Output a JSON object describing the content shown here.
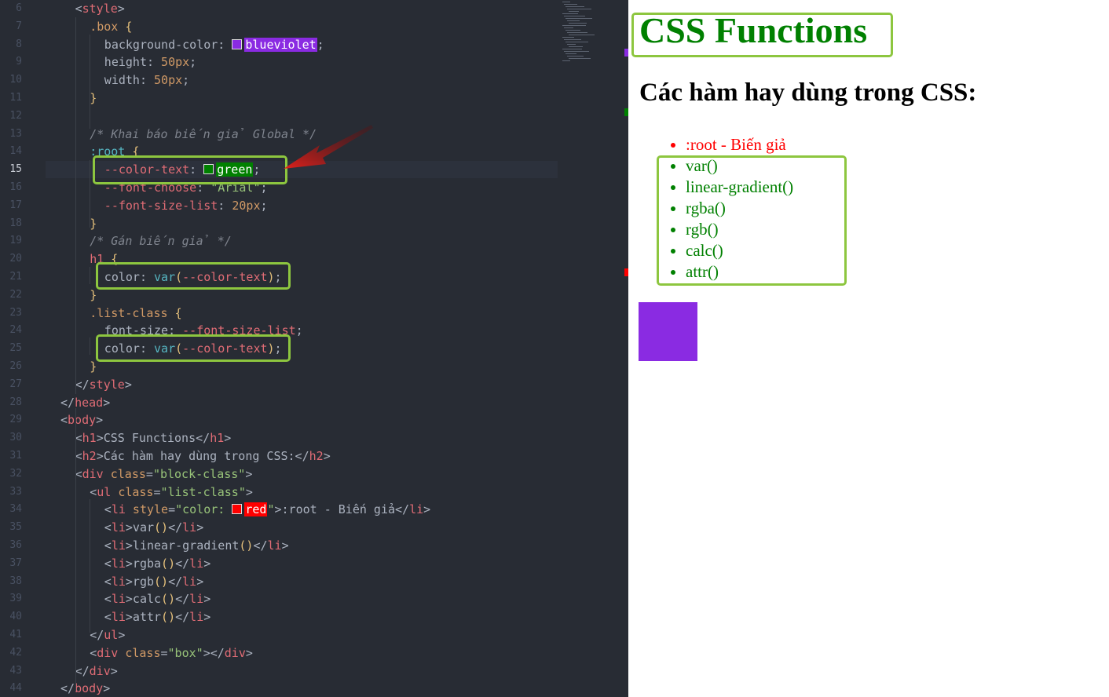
{
  "editor": {
    "current_line": 15,
    "lines": [
      {
        "n": 6,
        "indent": 1,
        "tokens": [
          [
            "t-br",
            "<"
          ],
          [
            "t-tag",
            "style"
          ],
          [
            "t-br",
            ">"
          ]
        ]
      },
      {
        "n": 7,
        "indent": 2,
        "tokens": [
          [
            "t-sel",
            ".box"
          ],
          [
            "t-br",
            " "
          ],
          [
            "t-cb",
            "{"
          ]
        ]
      },
      {
        "n": 8,
        "indent": 3,
        "tokens": [
          [
            "t-prop",
            "background-color: "
          ],
          [
            "swatch",
            "#8a2be2"
          ],
          [
            "hl:#8a2be2",
            "blueviolet"
          ],
          [
            "t-br",
            ";"
          ]
        ]
      },
      {
        "n": 9,
        "indent": 3,
        "tokens": [
          [
            "t-prop",
            "height: "
          ],
          [
            "t-num",
            "50px"
          ],
          [
            "t-br",
            ";"
          ]
        ]
      },
      {
        "n": 10,
        "indent": 3,
        "tokens": [
          [
            "t-prop",
            "width: "
          ],
          [
            "t-num",
            "50px"
          ],
          [
            "t-br",
            ";"
          ]
        ]
      },
      {
        "n": 11,
        "indent": 2,
        "tokens": [
          [
            "t-cb",
            "}"
          ]
        ]
      },
      {
        "n": 12,
        "indent": 0,
        "tokens": []
      },
      {
        "n": 13,
        "indent": 2,
        "tokens": [
          [
            "t-cm",
            "/* Khai báo biến giả Global */"
          ]
        ]
      },
      {
        "n": 14,
        "indent": 2,
        "tokens": [
          [
            "t-fn",
            ":root"
          ],
          [
            "t-br",
            " "
          ],
          [
            "t-cb",
            "{"
          ]
        ]
      },
      {
        "n": 15,
        "indent": 3,
        "tokens": [
          [
            "t-var",
            "--color-text"
          ],
          [
            "t-br",
            ": "
          ],
          [
            "swatch",
            "#008000"
          ],
          [
            "hl:#008000",
            "green"
          ],
          [
            "t-br",
            ";"
          ]
        ]
      },
      {
        "n": 16,
        "indent": 3,
        "tokens": [
          [
            "t-var",
            "--font-choose"
          ],
          [
            "t-br",
            ": "
          ],
          [
            "t-str",
            "\"Arial\""
          ],
          [
            "t-br",
            ";"
          ]
        ]
      },
      {
        "n": 17,
        "indent": 3,
        "tokens": [
          [
            "t-var",
            "--font-size-list"
          ],
          [
            "t-br",
            ": "
          ],
          [
            "t-num",
            "20px"
          ],
          [
            "t-br",
            ";"
          ]
        ]
      },
      {
        "n": 18,
        "indent": 2,
        "tokens": [
          [
            "t-cb",
            "}"
          ]
        ]
      },
      {
        "n": 19,
        "indent": 2,
        "tokens": [
          [
            "t-cm",
            "/* Gán biến giả */"
          ]
        ]
      },
      {
        "n": 20,
        "indent": 2,
        "tokens": [
          [
            "t-tag",
            "h1"
          ],
          [
            "t-br",
            " "
          ],
          [
            "t-cb",
            "{"
          ]
        ]
      },
      {
        "n": 21,
        "indent": 3,
        "tokens": [
          [
            "t-prop",
            "color: "
          ],
          [
            "t-fn",
            "var"
          ],
          [
            "t-cb",
            "("
          ],
          [
            "t-var",
            "--color-text"
          ],
          [
            "t-cb",
            ")"
          ],
          [
            "t-br",
            ";"
          ]
        ]
      },
      {
        "n": 22,
        "indent": 2,
        "tokens": [
          [
            "t-cb",
            "}"
          ]
        ]
      },
      {
        "n": 23,
        "indent": 2,
        "tokens": [
          [
            "t-sel",
            ".list-class"
          ],
          [
            "t-br",
            " "
          ],
          [
            "t-cb",
            "{"
          ]
        ]
      },
      {
        "n": 24,
        "indent": 3,
        "tokens": [
          [
            "t-prop",
            "font-size: "
          ],
          [
            "t-var",
            "--font-size-list"
          ],
          [
            "t-br",
            ";"
          ]
        ]
      },
      {
        "n": 25,
        "indent": 3,
        "tokens": [
          [
            "t-prop",
            "color: "
          ],
          [
            "t-fn",
            "var"
          ],
          [
            "t-cb",
            "("
          ],
          [
            "t-var",
            "--color-text"
          ],
          [
            "t-cb",
            ")"
          ],
          [
            "t-br",
            ";"
          ]
        ]
      },
      {
        "n": 26,
        "indent": 2,
        "tokens": [
          [
            "t-cb",
            "}"
          ]
        ]
      },
      {
        "n": 27,
        "indent": 1,
        "tokens": [
          [
            "t-br",
            "</"
          ],
          [
            "t-tag",
            "style"
          ],
          [
            "t-br",
            ">"
          ]
        ]
      },
      {
        "n": 28,
        "indent": 0,
        "tokens": [
          [
            "t-br",
            "</"
          ],
          [
            "t-tag",
            "head"
          ],
          [
            "t-br",
            ">"
          ]
        ]
      },
      {
        "n": 29,
        "indent": 0,
        "tokens": [
          [
            "t-br",
            "<"
          ],
          [
            "t-tag",
            "body"
          ],
          [
            "t-br",
            ">"
          ]
        ]
      },
      {
        "n": 30,
        "indent": 1,
        "tokens": [
          [
            "t-br",
            "<"
          ],
          [
            "t-tag",
            "h1"
          ],
          [
            "t-br",
            ">CSS Functions</"
          ],
          [
            "t-tag",
            "h1"
          ],
          [
            "t-br",
            ">"
          ]
        ]
      },
      {
        "n": 31,
        "indent": 1,
        "tokens": [
          [
            "t-br",
            "<"
          ],
          [
            "t-tag",
            "h2"
          ],
          [
            "t-br",
            ">Các hàm hay dùng trong CSS:</"
          ],
          [
            "t-tag",
            "h2"
          ],
          [
            "t-br",
            ">"
          ]
        ]
      },
      {
        "n": 32,
        "indent": 1,
        "tokens": [
          [
            "t-br",
            "<"
          ],
          [
            "t-tag",
            "div"
          ],
          [
            "t-br",
            " "
          ],
          [
            "t-attr",
            "class"
          ],
          [
            "t-br",
            "="
          ],
          [
            "t-str",
            "\"block-class\""
          ],
          [
            "t-br",
            ">"
          ]
        ]
      },
      {
        "n": 33,
        "indent": 2,
        "tokens": [
          [
            "t-br",
            "<"
          ],
          [
            "t-tag",
            "ul"
          ],
          [
            "t-br",
            " "
          ],
          [
            "t-attr",
            "class"
          ],
          [
            "t-br",
            "="
          ],
          [
            "t-str",
            "\"list-class\""
          ],
          [
            "t-br",
            ">"
          ]
        ]
      },
      {
        "n": 34,
        "indent": 3,
        "tokens": [
          [
            "t-br",
            "<"
          ],
          [
            "t-tag",
            "li"
          ],
          [
            "t-br",
            " "
          ],
          [
            "t-attr",
            "style"
          ],
          [
            "t-br",
            "="
          ],
          [
            "t-str",
            "\"color: "
          ],
          [
            "swatch",
            "#ff0000"
          ],
          [
            "hl:#ff0000",
            "red"
          ],
          [
            "t-str",
            "\""
          ],
          [
            "t-br",
            ">:root - Biến giả</"
          ],
          [
            "t-tag",
            "li"
          ],
          [
            "t-br",
            ">"
          ]
        ]
      },
      {
        "n": 35,
        "indent": 3,
        "tokens": [
          [
            "t-br",
            "<"
          ],
          [
            "t-tag",
            "li"
          ],
          [
            "t-br",
            ">var"
          ],
          [
            "t-cb",
            "()"
          ],
          [
            "t-br",
            "</"
          ],
          [
            "t-tag",
            "li"
          ],
          [
            "t-br",
            ">"
          ]
        ]
      },
      {
        "n": 36,
        "indent": 3,
        "tokens": [
          [
            "t-br",
            "<"
          ],
          [
            "t-tag",
            "li"
          ],
          [
            "t-br",
            ">linear-gradient"
          ],
          [
            "t-cb",
            "()"
          ],
          [
            "t-br",
            "</"
          ],
          [
            "t-tag",
            "li"
          ],
          [
            "t-br",
            ">"
          ]
        ]
      },
      {
        "n": 37,
        "indent": 3,
        "tokens": [
          [
            "t-br",
            "<"
          ],
          [
            "t-tag",
            "li"
          ],
          [
            "t-br",
            ">rgba"
          ],
          [
            "t-cb",
            "()"
          ],
          [
            "t-br",
            "</"
          ],
          [
            "t-tag",
            "li"
          ],
          [
            "t-br",
            ">"
          ]
        ]
      },
      {
        "n": 38,
        "indent": 3,
        "tokens": [
          [
            "t-br",
            "<"
          ],
          [
            "t-tag",
            "li"
          ],
          [
            "t-br",
            ">rgb"
          ],
          [
            "t-cb",
            "()"
          ],
          [
            "t-br",
            "</"
          ],
          [
            "t-tag",
            "li"
          ],
          [
            "t-br",
            ">"
          ]
        ]
      },
      {
        "n": 39,
        "indent": 3,
        "tokens": [
          [
            "t-br",
            "<"
          ],
          [
            "t-tag",
            "li"
          ],
          [
            "t-br",
            ">calc"
          ],
          [
            "t-cb",
            "()"
          ],
          [
            "t-br",
            "</"
          ],
          [
            "t-tag",
            "li"
          ],
          [
            "t-br",
            ">"
          ]
        ]
      },
      {
        "n": 40,
        "indent": 3,
        "tokens": [
          [
            "t-br",
            "<"
          ],
          [
            "t-tag",
            "li"
          ],
          [
            "t-br",
            ">attr"
          ],
          [
            "t-cb",
            "()"
          ],
          [
            "t-br",
            "</"
          ],
          [
            "t-tag",
            "li"
          ],
          [
            "t-br",
            ">"
          ]
        ]
      },
      {
        "n": 41,
        "indent": 2,
        "tokens": [
          [
            "t-br",
            "</"
          ],
          [
            "t-tag",
            "ul"
          ],
          [
            "t-br",
            ">"
          ]
        ]
      },
      {
        "n": 42,
        "indent": 2,
        "tokens": [
          [
            "t-br",
            "<"
          ],
          [
            "t-tag",
            "div"
          ],
          [
            "t-br",
            " "
          ],
          [
            "t-attr",
            "class"
          ],
          [
            "t-br",
            "="
          ],
          [
            "t-str",
            "\"box\""
          ],
          [
            "t-br",
            "></"
          ],
          [
            "t-tag",
            "div"
          ],
          [
            "t-br",
            ">"
          ]
        ]
      },
      {
        "n": 43,
        "indent": 1,
        "tokens": [
          [
            "t-br",
            "</"
          ],
          [
            "t-tag",
            "div"
          ],
          [
            "t-br",
            ">"
          ]
        ]
      },
      {
        "n": 44,
        "indent": 0,
        "tokens": [
          [
            "t-br",
            "</"
          ],
          [
            "t-tag",
            "body"
          ],
          [
            "t-br",
            ">"
          ]
        ]
      }
    ]
  },
  "browser": {
    "h1": "CSS Functions",
    "h2": "Các hàm hay dùng trong CSS:",
    "list": [
      {
        "text": ":root - Biến giả",
        "color": "#ff0000"
      },
      {
        "text": "var()"
      },
      {
        "text": "linear-gradient()"
      },
      {
        "text": "rgba()"
      },
      {
        "text": "rgb()"
      },
      {
        "text": "calc()"
      },
      {
        "text": "attr()"
      }
    ],
    "list_color": "#008000",
    "box_color": "#8a2be2"
  },
  "annotation": {
    "highlight_color": "#8dc63f",
    "arrow_color": "#e0201b"
  }
}
